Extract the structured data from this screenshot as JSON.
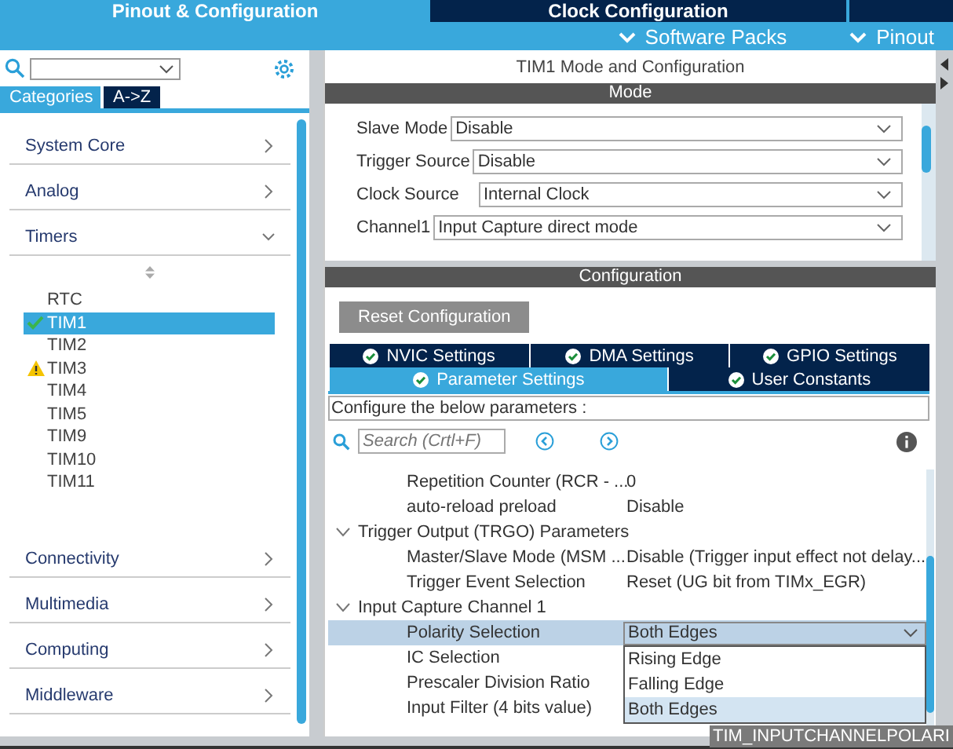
{
  "top_tabs": [
    {
      "label": "Pinout & Configuration",
      "selected": true
    },
    {
      "label": "Clock Configuration",
      "selected": false
    },
    {
      "selected": false
    }
  ],
  "menu": [
    "Software Packs",
    "Pinout"
  ],
  "sidebar": {
    "view_tabs": [
      {
        "label": "Categories",
        "selected": true
      },
      {
        "label": "A->Z",
        "selected": false
      }
    ],
    "categories": [
      {
        "label": "System Core",
        "expanded": false
      },
      {
        "label": "Analog",
        "expanded": false
      },
      {
        "label": "Timers",
        "expanded": true,
        "children": [
          {
            "label": "RTC",
            "configured": false,
            "warning": false,
            "selected": false
          },
          {
            "label": "TIM1",
            "configured": true,
            "warning": false,
            "selected": true
          },
          {
            "label": "TIM2",
            "configured": false,
            "warning": false,
            "selected": false
          },
          {
            "label": "TIM3",
            "configured": false,
            "warning": true,
            "selected": false
          },
          {
            "label": "TIM4",
            "configured": false,
            "warning": false,
            "selected": false
          },
          {
            "label": "TIM5",
            "configured": false,
            "warning": false,
            "selected": false
          },
          {
            "label": "TIM9",
            "configured": false,
            "warning": false,
            "selected": false
          },
          {
            "label": "TIM10",
            "configured": false,
            "warning": false,
            "selected": false
          },
          {
            "label": "TIM11",
            "configured": false,
            "warning": false,
            "selected": false
          }
        ]
      },
      {
        "label": "Connectivity",
        "expanded": false
      },
      {
        "label": "Multimedia",
        "expanded": false
      },
      {
        "label": "Computing",
        "expanded": false
      },
      {
        "label": "Middleware",
        "expanded": false
      }
    ]
  },
  "panel": {
    "title": "TIM1 Mode and Configuration",
    "mode_header": "Mode",
    "mode_fields": [
      {
        "label": "Slave Mode",
        "value": "Disable"
      },
      {
        "label": "Trigger Source",
        "value": "Disable"
      },
      {
        "label": "Clock Source",
        "value": "Internal Clock"
      },
      {
        "label": "Channel1",
        "value": "Input Capture direct mode"
      }
    ],
    "config_header": "Configuration",
    "reset_button": "Reset Configuration",
    "tabs_row1": [
      {
        "label": "NVIC Settings",
        "selected": false
      },
      {
        "label": "DMA Settings",
        "selected": false
      },
      {
        "label": "GPIO Settings",
        "selected": false
      }
    ],
    "tabs_row2": [
      {
        "label": "Parameter Settings",
        "selected": true
      },
      {
        "label": "User Constants",
        "selected": false
      }
    ],
    "hint": "Configure the below parameters :",
    "search": {
      "placeholder": "Search (Crtl+F)"
    },
    "params": [
      {
        "kind": "param",
        "label": "Repetition Counter (RCR - ...",
        "value": "0",
        "selected": false
      },
      {
        "kind": "param",
        "label": "auto-reload preload",
        "value": "Disable",
        "selected": false
      },
      {
        "kind": "group",
        "label": "Trigger Output (TRGO) Parameters",
        "expanded": true,
        "children": [
          {
            "kind": "param",
            "label": "Master/Slave Mode (MSM ...",
            "value": "Disable (Trigger input effect not delay...",
            "selected": false
          },
          {
            "kind": "param",
            "label": "Trigger Event Selection",
            "value": "Reset (UG bit from TIMx_EGR)",
            "selected": false
          }
        ]
      },
      {
        "kind": "group",
        "label": "Input Capture Channel 1",
        "expanded": true,
        "children": [
          {
            "kind": "combo",
            "label": "Polarity Selection",
            "value": "Both Edges",
            "selected": true
          },
          {
            "kind": "param",
            "label": "IC Selection",
            "selected": false
          },
          {
            "kind": "param",
            "label": "Prescaler Division Ratio",
            "selected": false
          },
          {
            "kind": "param",
            "label": "Input Filter (4 bits value)",
            "selected": false
          }
        ]
      }
    ],
    "dropdown_options": [
      {
        "label": "Rising Edge",
        "selected": false
      },
      {
        "label": "Falling Edge",
        "selected": false
      },
      {
        "label": "Both Edges",
        "selected": true
      }
    ],
    "tooltip": "TIM_INPUTCHANNELPOLARI"
  }
}
